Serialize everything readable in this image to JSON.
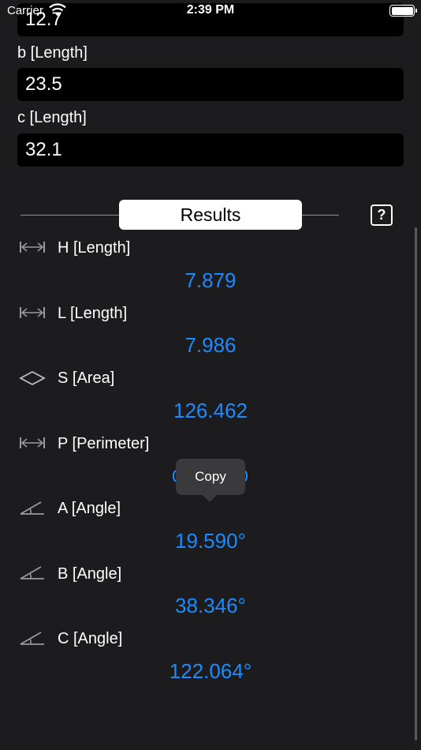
{
  "status_bar": {
    "carrier": "Carrier",
    "time": "2:39 PM",
    "battery_level": 1.0
  },
  "inputs": [
    {
      "label": "",
      "value": "12.7"
    },
    {
      "label": "b [Length]",
      "value": "23.5"
    },
    {
      "label": "c [Length]",
      "value": "32.1"
    }
  ],
  "results_header": {
    "title": "Results",
    "help_label": "?"
  },
  "results": [
    {
      "icon": "length-arrows-icon",
      "label": "H [Length]",
      "value": "7.879"
    },
    {
      "icon": "length-arrows-icon",
      "label": "L [Length]",
      "value": "7.986"
    },
    {
      "icon": "area-diamond-icon",
      "label": "S [Area]",
      "value": "126.462"
    },
    {
      "icon": "length-arrows-icon",
      "label": "P [Perimeter]",
      "value": ""
    },
    {
      "icon": "angle-icon",
      "label": "A [Angle]",
      "value": "19.590°"
    },
    {
      "icon": "angle-icon",
      "label": "B [Angle]",
      "value": "38.346°"
    },
    {
      "icon": "angle-icon",
      "label": "C [Angle]",
      "value": "122.064°"
    }
  ],
  "tooltip": {
    "label": "Copy"
  },
  "colors": {
    "background": "#1c1c1e",
    "input_bg": "#000000",
    "accent": "#1a8cff",
    "tooltip_bg": "#3a3a3c"
  }
}
